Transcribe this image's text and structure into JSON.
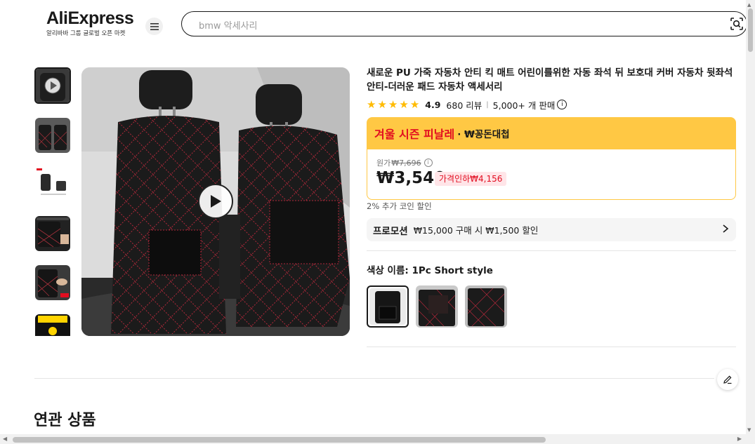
{
  "header": {
    "logo_text": "AliExpress",
    "logo_sub": "알리바바 그룹 글로벌 오픈 마켓",
    "search_value": "bmw 악세사리"
  },
  "product": {
    "title": "새로운 PU 가죽 자동차 안티 킥 매트 어린이를위한 자동 좌석 뒤 보호대 커버 자동차 뒷좌석 안티-더러운 패드 자동차 액세서리",
    "rating": "4.9",
    "reviews": "680 리뷰",
    "sold": "5,000+ 개 판매",
    "stars": 5
  },
  "sale": {
    "title": "겨울 시즌 피날레",
    "subtitle": "· ₩꽁돈대첩"
  },
  "price": {
    "orig_label": "원가",
    "orig_value": "₩7,696",
    "current": "₩3,540",
    "discount": "가격인하₩4,156"
  },
  "coin_note": "2% 추가 코인 할인",
  "promo": {
    "tag": "프로모션",
    "text": "₩15,000 구매 시 ₩1,500 할인"
  },
  "color": {
    "label": "색상 이름: ",
    "value": "1Pc Short style"
  },
  "related_title": "연관 상품",
  "colors": {
    "accent_red": "#e20d20",
    "banner_yellow": "#ffc844",
    "star": "#ffbb00"
  }
}
